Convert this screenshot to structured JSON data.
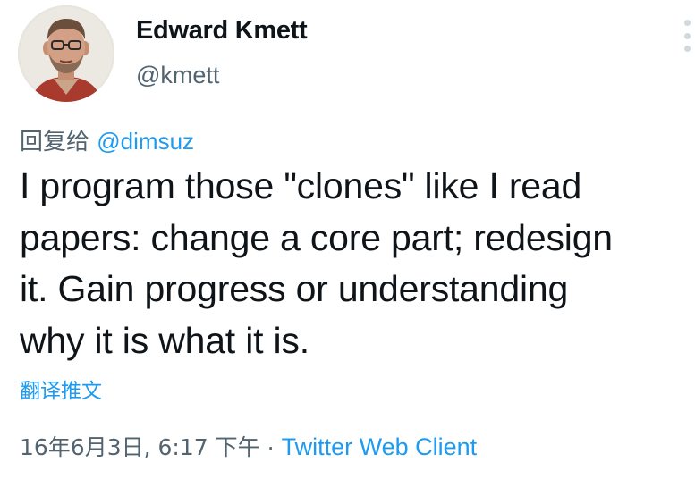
{
  "author": {
    "display_name": "Edward Kmett",
    "handle": "@kmett",
    "avatar_icon": "user-photo"
  },
  "reply": {
    "prefix": "回复给",
    "mention": "@dimsuz"
  },
  "tweet": {
    "lines": [
      "I program those \"clones\" like I read",
      "papers: change a core part; redesign",
      "it. Gain progress or understanding",
      "why it is what it is."
    ]
  },
  "translate_label": "翻译推文",
  "meta": {
    "timestamp": "16年6月3日, 6:17 下午",
    "separator": " · ",
    "source": "Twitter Web Client"
  },
  "colors": {
    "text": "#0f1419",
    "secondary": "#536471",
    "link": "#1d9bf0"
  },
  "icons": {
    "more": "more-vertical-icon"
  }
}
